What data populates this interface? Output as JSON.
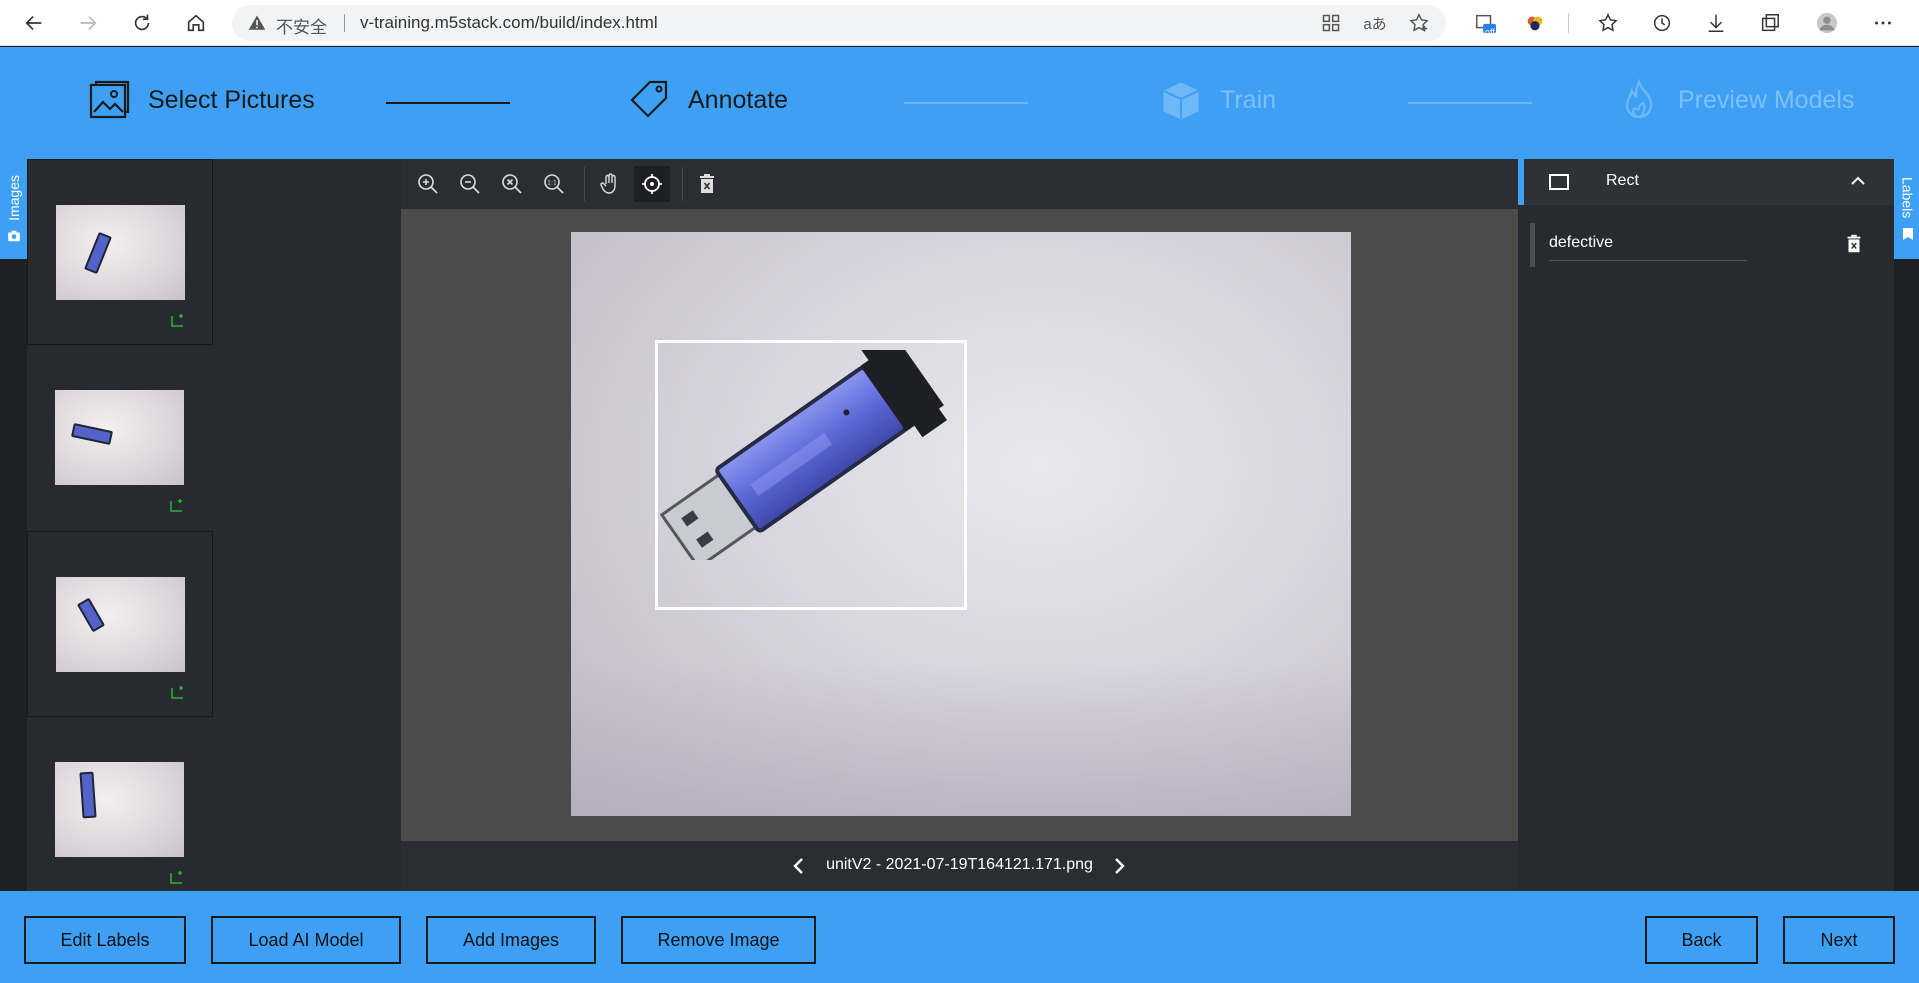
{
  "browser": {
    "security_label": "不安全",
    "url": "v-training.m5stack.com/build/index.html",
    "ext_badge": "off"
  },
  "steps": [
    {
      "label": "Select Pictures",
      "state": "done"
    },
    {
      "label": "Annotate",
      "state": "current"
    },
    {
      "label": "Train",
      "state": "upcoming"
    },
    {
      "label": "Preview Models",
      "state": "upcoming"
    }
  ],
  "side_tabs": {
    "images": "Images",
    "labels": "Labels"
  },
  "editor": {
    "tools": [
      "zoom-in",
      "zoom-out",
      "zoom-fit",
      "zoom-actual",
      "pan",
      "select",
      "delete"
    ],
    "active_tool": "select",
    "filename": "unitV2 - 2021-07-19T164121.171.png"
  },
  "labels_panel": {
    "shape_type": "Rect",
    "labels": [
      {
        "value": "defective"
      }
    ]
  },
  "footer": {
    "edit_labels": "Edit Labels",
    "load_ai_model": "Load AI Model",
    "add_images": "Add Images",
    "remove_image": "Remove Image",
    "back": "Back",
    "next": "Next"
  },
  "colors": {
    "accent": "#3ea0f5",
    "dark": "#272a2e",
    "tag_green": "#29b43a"
  }
}
